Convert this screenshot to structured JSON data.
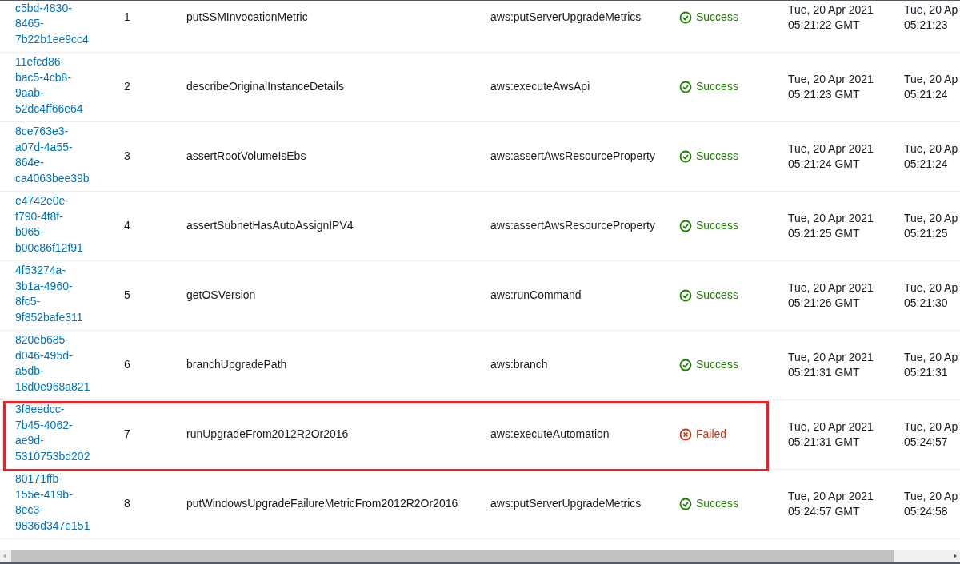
{
  "table": {
    "rows": [
      {
        "id": "c5bd-4830-8465-7b22b1ee9cc4",
        "step": "1",
        "name": "putSSMInvocationMetric",
        "action": "aws:putServerUpgradeMetrics",
        "status": {
          "kind": "success",
          "label": "Success"
        },
        "start": [
          "Tue, 20 Apr 2021",
          "05:21:22 GMT"
        ],
        "end": [
          "Tue, 20 Ap",
          "05:21:23"
        ],
        "highlighted": false
      },
      {
        "id": "11efcd86-bac5-4cb8-9aab-52dc4ff66e64",
        "step": "2",
        "name": "describeOriginalInstanceDetails",
        "action": "aws:executeAwsApi",
        "status": {
          "kind": "success",
          "label": "Success"
        },
        "start": [
          "Tue, 20 Apr 2021",
          "05:21:23 GMT"
        ],
        "end": [
          "Tue, 20 Ap",
          "05:21:24"
        ],
        "highlighted": false
      },
      {
        "id": "8ce763e3-a07d-4a55-864e-ca4063bee39b",
        "step": "3",
        "name": "assertRootVolumeIsEbs",
        "action": "aws:assertAwsResourceProperty",
        "status": {
          "kind": "success",
          "label": "Success"
        },
        "start": [
          "Tue, 20 Apr 2021",
          "05:21:24 GMT"
        ],
        "end": [
          "Tue, 20 Ap",
          "05:21:24"
        ],
        "highlighted": false
      },
      {
        "id": "e4742e0e-f790-4f8f-b065-b00c86f12f91",
        "step": "4",
        "name": "assertSubnetHasAutoAssignIPV4",
        "action": "aws:assertAwsResourceProperty",
        "status": {
          "kind": "success",
          "label": "Success"
        },
        "start": [
          "Tue, 20 Apr 2021",
          "05:21:25 GMT"
        ],
        "end": [
          "Tue, 20 Ap",
          "05:21:25"
        ],
        "highlighted": false
      },
      {
        "id": "4f53274a-3b1a-4960-8fc5-9f852bafe311",
        "step": "5",
        "name": "getOSVersion",
        "action": "aws:runCommand",
        "status": {
          "kind": "success",
          "label": "Success"
        },
        "start": [
          "Tue, 20 Apr 2021",
          "05:21:26 GMT"
        ],
        "end": [
          "Tue, 20 Ap",
          "05:21:30"
        ],
        "highlighted": false
      },
      {
        "id": "820eb685-d046-495d-a5db-18d0e968a821",
        "step": "6",
        "name": "branchUpgradePath",
        "action": "aws:branch",
        "status": {
          "kind": "success",
          "label": "Success"
        },
        "start": [
          "Tue, 20 Apr 2021",
          "05:21:31 GMT"
        ],
        "end": [
          "Tue, 20 Ap",
          "05:21:31"
        ],
        "highlighted": false
      },
      {
        "id": "3f8eedcc-7b45-4062-ae9d-5310753bd202",
        "step": "7",
        "name": "runUpgradeFrom2012R2Or2016",
        "action": "aws:executeAutomation",
        "status": {
          "kind": "failed",
          "label": "Failed"
        },
        "start": [
          "Tue, 20 Apr 2021",
          "05:21:31 GMT"
        ],
        "end": [
          "Tue, 20 Ap",
          "05:24:57"
        ],
        "highlighted": true
      },
      {
        "id": "80171ffb-155e-419b-8ec3-9836d347e151",
        "step": "8",
        "name": "putWindowsUpgradeFailureMetricFrom2012R2Or2016",
        "action": "aws:putServerUpgradeMetrics",
        "status": {
          "kind": "success",
          "label": "Success"
        },
        "start": [
          "Tue, 20 Apr 2021",
          "05:24:57 GMT"
        ],
        "end": [
          "Tue, 20 Ap",
          "05:24:58"
        ],
        "highlighted": false
      }
    ]
  }
}
